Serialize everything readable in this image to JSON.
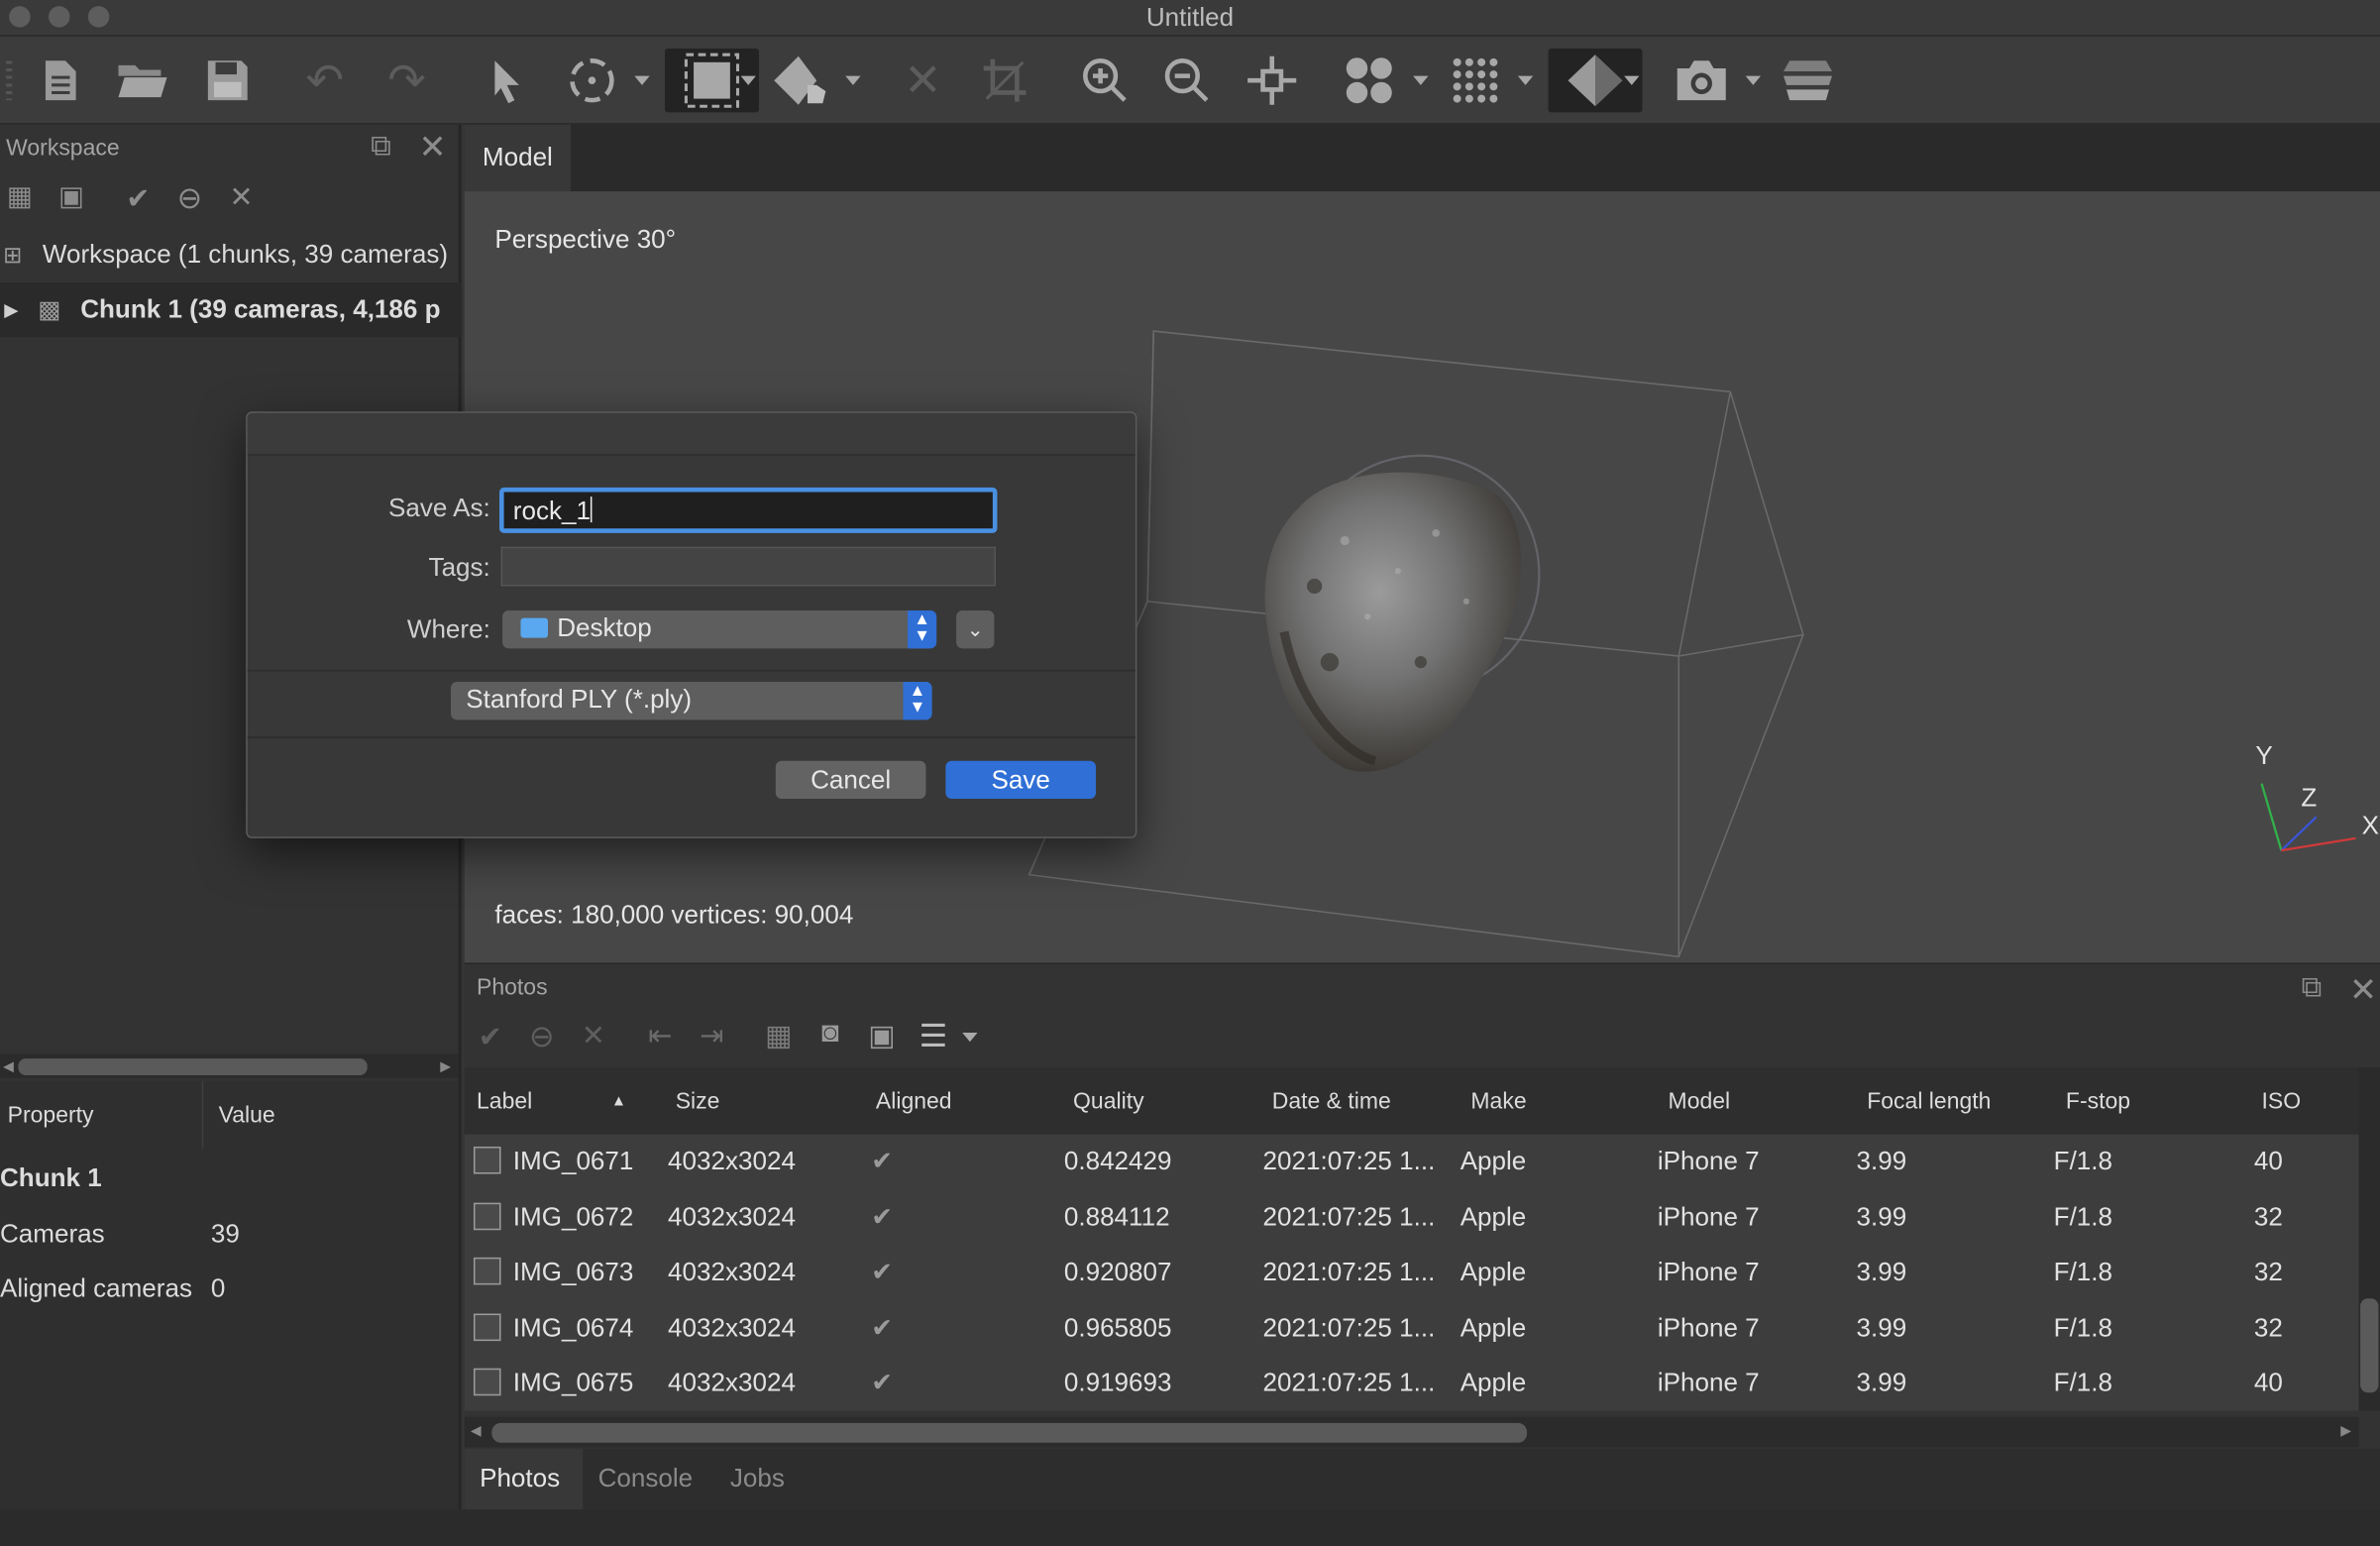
{
  "window": {
    "title": "Untitled"
  },
  "workspace": {
    "panel_title": "Workspace",
    "root_label": "Workspace (1 chunks, 39 cameras)",
    "chunk_label": "Chunk 1 (39 cameras, 4,186 p"
  },
  "properties": {
    "col_property": "Property",
    "col_value": "Value",
    "section": "Chunk 1",
    "rows": [
      {
        "name": "Cameras",
        "value": "39"
      },
      {
        "name": "Aligned cameras",
        "value": "0"
      }
    ]
  },
  "model": {
    "tab": "Model",
    "projection": "Perspective 30°",
    "stats": "faces: 180,000 vertices: 90,004",
    "axes": {
      "y": "Y",
      "z": "Z",
      "x": "X"
    }
  },
  "photos": {
    "panel_title": "Photos",
    "columns": [
      "Label",
      "Size",
      "Aligned",
      "Quality",
      "Date & time",
      "Make",
      "Model",
      "Focal length",
      "F-stop",
      "ISO"
    ],
    "rows": [
      {
        "label": "IMG_0671",
        "size": "4032x3024",
        "aligned": "✔",
        "quality": "0.842429",
        "datetime": "2021:07:25 1...",
        "make": "Apple",
        "model": "iPhone 7",
        "focal": "3.99",
        "fstop": "F/1.8",
        "iso": "40"
      },
      {
        "label": "IMG_0672",
        "size": "4032x3024",
        "aligned": "✔",
        "quality": "0.884112",
        "datetime": "2021:07:25 1...",
        "make": "Apple",
        "model": "iPhone 7",
        "focal": "3.99",
        "fstop": "F/1.8",
        "iso": "32"
      },
      {
        "label": "IMG_0673",
        "size": "4032x3024",
        "aligned": "✔",
        "quality": "0.920807",
        "datetime": "2021:07:25 1...",
        "make": "Apple",
        "model": "iPhone 7",
        "focal": "3.99",
        "fstop": "F/1.8",
        "iso": "32"
      },
      {
        "label": "IMG_0674",
        "size": "4032x3024",
        "aligned": "✔",
        "quality": "0.965805",
        "datetime": "2021:07:25 1...",
        "make": "Apple",
        "model": "iPhone 7",
        "focal": "3.99",
        "fstop": "F/1.8",
        "iso": "32"
      },
      {
        "label": "IMG_0675",
        "size": "4032x3024",
        "aligned": "✔",
        "quality": "0.919693",
        "datetime": "2021:07:25 1...",
        "make": "Apple",
        "model": "iPhone 7",
        "focal": "3.99",
        "fstop": "F/1.8",
        "iso": "40"
      }
    ]
  },
  "bottom_tabs": [
    "Photos",
    "Console",
    "Jobs"
  ],
  "dialog": {
    "save_as_label": "Save As:",
    "save_as_value": "rock_1",
    "tags_label": "Tags:",
    "tags_value": "",
    "where_label": "Where:",
    "where_value": "Desktop",
    "format_value": "Stanford PLY (*.ply)",
    "cancel_label": "Cancel",
    "save_label": "Save"
  },
  "colors": {
    "accent": "#2f6fd6",
    "focus_ring": "#4a90e2",
    "folder": "#5aa8f0"
  }
}
